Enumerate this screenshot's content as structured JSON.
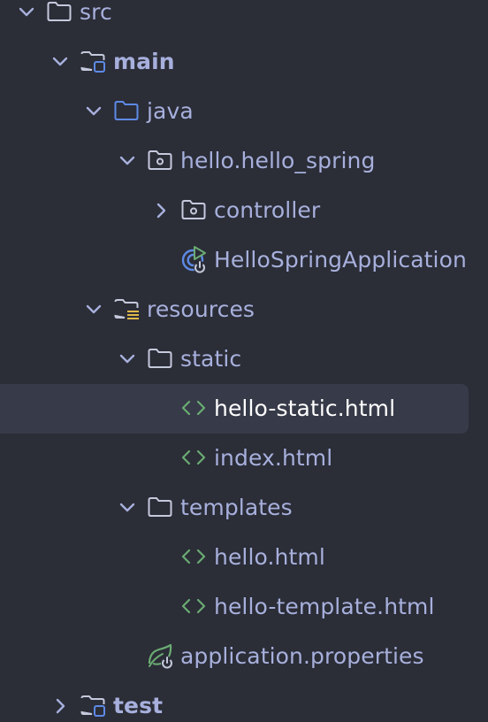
{
  "tree": {
    "src": "src",
    "main": "main",
    "java": "java",
    "package": "hello.hello_spring",
    "controller": "controller",
    "app_class": "HelloSpringApplication",
    "resources": "resources",
    "static": "static",
    "hello_static": "hello-static.html",
    "index": "index.html",
    "templates": "templates",
    "hello_html": "hello.html",
    "hello_template": "hello-template.html",
    "app_props": "application.properties",
    "test": "test"
  },
  "icons": {
    "folder": "folder-icon",
    "source-root": "source-root-folder-icon",
    "package": "package-icon",
    "resources": "resources-folder-icon",
    "html": "html-file-icon",
    "spring-app": "spring-boot-application-icon",
    "spring-props": "spring-properties-icon"
  },
  "colors": {
    "background": "#2b2d37",
    "text": "#a7b0dc",
    "selected_text": "#ffffff",
    "selection": "#373a48",
    "html_icon": "#6aab73",
    "java_blue": "#5e8ae6",
    "resources_yellow": "#e0b84a"
  }
}
